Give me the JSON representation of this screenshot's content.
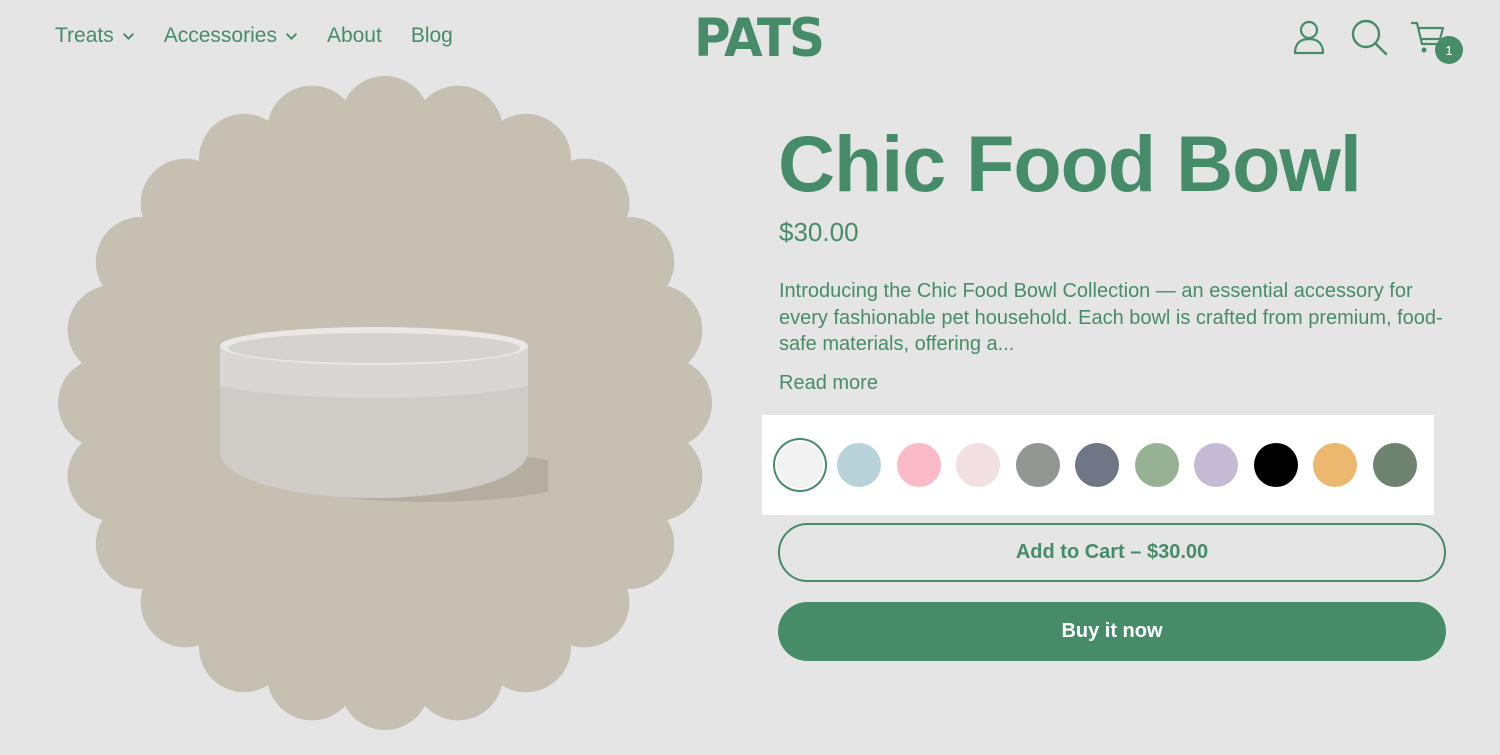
{
  "nav": {
    "items": [
      {
        "label": "Treats",
        "has_dropdown": true
      },
      {
        "label": "Accessories",
        "has_dropdown": true
      },
      {
        "label": "About",
        "has_dropdown": false
      },
      {
        "label": "Blog",
        "has_dropdown": false
      }
    ]
  },
  "logo": {
    "text": "PATS"
  },
  "header_icons": {
    "account": "user-icon",
    "search": "search-icon",
    "cart": "cart-icon",
    "cart_count": "1"
  },
  "product": {
    "title": "Chic Food Bowl",
    "price": "$30.00",
    "description": "Introducing the Chic Food Bowl Collection — an essential accessory for every fashionable pet household. Each bowl is crafted from premium, food-safe materials, offering a...",
    "read_more": "Read more",
    "image_bg_color": "#c6c0b2",
    "swatches": [
      {
        "color": "#f2f2f2",
        "selected": true
      },
      {
        "color": "#b8d2d9",
        "selected": false
      },
      {
        "color": "#fbbac8",
        "selected": false
      },
      {
        "color": "#f1dfe1",
        "selected": false
      },
      {
        "color": "#929693",
        "selected": false
      },
      {
        "color": "#6f7686",
        "selected": false
      },
      {
        "color": "#97b195",
        "selected": false
      },
      {
        "color": "#c5bad3",
        "selected": false
      },
      {
        "color": "#000000",
        "selected": false
      },
      {
        "color": "#ecb76e",
        "selected": false
      },
      {
        "color": "#6d836f",
        "selected": false
      }
    ],
    "add_to_cart": "Add to Cart – $30.00",
    "buy_now": "Buy it now"
  },
  "colors": {
    "brand": "#478c69",
    "background": "#e5e5e5"
  }
}
